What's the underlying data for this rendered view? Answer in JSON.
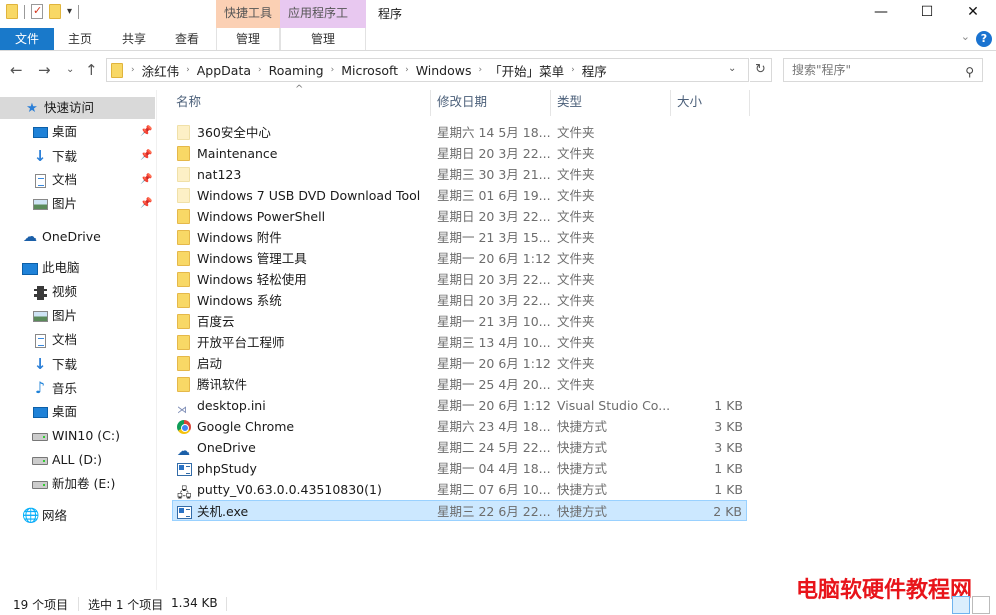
{
  "window": {
    "title": "程序",
    "context_tabs": [
      "快捷工具",
      "应用程序工具"
    ],
    "controls": {
      "minimize": "—",
      "maximize": "☐",
      "close": "✕"
    }
  },
  "ribbon": {
    "file": "文件",
    "tabs": [
      "主页",
      "共享",
      "查看"
    ],
    "context_subtabs": [
      "管理",
      "管理"
    ],
    "help": "?",
    "collapse": "⌄"
  },
  "nav": {
    "back": "←",
    "forward": "→",
    "recent": "⌄",
    "up": "↑",
    "breadcrumb": [
      "涂红伟",
      "AppData",
      "Roaming",
      "Microsoft",
      "Windows",
      "「开始」菜单",
      "程序"
    ],
    "refresh": "↻",
    "search_placeholder": "搜索\"程序\"",
    "search_icon": "⚲"
  },
  "sidebar": {
    "quick_access": {
      "label": "快速访问",
      "icon": "star-icon"
    },
    "quick_items": [
      {
        "label": "桌面",
        "icon": "desktop-icon",
        "pinned": true
      },
      {
        "label": "下载",
        "icon": "download-icon",
        "pinned": true
      },
      {
        "label": "文档",
        "icon": "documents-icon",
        "pinned": true
      },
      {
        "label": "图片",
        "icon": "pictures-icon",
        "pinned": true
      }
    ],
    "onedrive": {
      "label": "OneDrive",
      "icon": "onedrive-icon"
    },
    "this_pc": {
      "label": "此电脑",
      "icon": "computer-icon"
    },
    "pc_items": [
      {
        "label": "视频",
        "icon": "videos-icon"
      },
      {
        "label": "图片",
        "icon": "pictures-icon"
      },
      {
        "label": "文档",
        "icon": "documents-icon"
      },
      {
        "label": "下载",
        "icon": "download-icon"
      },
      {
        "label": "音乐",
        "icon": "music-icon"
      },
      {
        "label": "桌面",
        "icon": "desktop-icon"
      },
      {
        "label": "WIN10 (C:)",
        "icon": "drive-icon"
      },
      {
        "label": "ALL (D:)",
        "icon": "drive-icon"
      },
      {
        "label": "新加卷 (E:)",
        "icon": "drive-icon"
      }
    ],
    "network": {
      "label": "网络",
      "icon": "network-icon"
    }
  },
  "columns": {
    "name": "名称",
    "date": "修改日期",
    "type": "类型",
    "size": "大小"
  },
  "files": [
    {
      "name": "360安全中心",
      "date": "星期六 14 5月 18...",
      "type": "文件夹",
      "size": "",
      "icon": "folder-light"
    },
    {
      "name": "Maintenance",
      "date": "星期日 20 3月 22...",
      "type": "文件夹",
      "size": "",
      "icon": "folder"
    },
    {
      "name": "nat123",
      "date": "星期三 30 3月 21...",
      "type": "文件夹",
      "size": "",
      "icon": "folder-light"
    },
    {
      "name": "Windows 7 USB DVD Download Tool",
      "date": "星期三 01 6月 19...",
      "type": "文件夹",
      "size": "",
      "icon": "folder-light"
    },
    {
      "name": "Windows PowerShell",
      "date": "星期日 20 3月 22...",
      "type": "文件夹",
      "size": "",
      "icon": "folder"
    },
    {
      "name": "Windows 附件",
      "date": "星期一 21 3月 15...",
      "type": "文件夹",
      "size": "",
      "icon": "folder"
    },
    {
      "name": "Windows 管理工具",
      "date": "星期一 20 6月 1:12",
      "type": "文件夹",
      "size": "",
      "icon": "folder"
    },
    {
      "name": "Windows 轻松使用",
      "date": "星期日 20 3月 22...",
      "type": "文件夹",
      "size": "",
      "icon": "folder"
    },
    {
      "name": "Windows 系统",
      "date": "星期日 20 3月 22...",
      "type": "文件夹",
      "size": "",
      "icon": "folder"
    },
    {
      "name": "百度云",
      "date": "星期一 21 3月 10...",
      "type": "文件夹",
      "size": "",
      "icon": "folder"
    },
    {
      "name": "开放平台工程师",
      "date": "星期三 13 4月 10...",
      "type": "文件夹",
      "size": "",
      "icon": "folder"
    },
    {
      "name": "启动",
      "date": "星期一 20 6月 1:12",
      "type": "文件夹",
      "size": "",
      "icon": "folder"
    },
    {
      "name": "腾讯软件",
      "date": "星期一 25 4月 20...",
      "type": "文件夹",
      "size": "",
      "icon": "folder"
    },
    {
      "name": "desktop.ini",
      "date": "星期一 20 6月 1:12",
      "type": "Visual Studio Co...",
      "size": "1 KB",
      "icon": "ini"
    },
    {
      "name": "Google Chrome",
      "date": "星期六 23 4月 18...",
      "type": "快捷方式",
      "size": "3 KB",
      "icon": "chrome"
    },
    {
      "name": "OneDrive",
      "date": "星期二 24 5月 22...",
      "type": "快捷方式",
      "size": "3 KB",
      "icon": "onedrive"
    },
    {
      "name": "phpStudy",
      "date": "星期一 04 4月 18...",
      "type": "快捷方式",
      "size": "1 KB",
      "icon": "app"
    },
    {
      "name": "putty_V0.63.0.0.43510830(1)",
      "date": "星期二 07 6月 10...",
      "type": "快捷方式",
      "size": "1 KB",
      "icon": "putty"
    },
    {
      "name": "关机.exe",
      "date": "星期三 22 6月 22...",
      "type": "快捷方式",
      "size": "2 KB",
      "icon": "app",
      "selected": true
    }
  ],
  "status": {
    "count": "19 个项目",
    "selected": "选中 1 个项目",
    "selected_size": "1.34 KB"
  },
  "watermark": "电脑软硬件教程网",
  "colors": {
    "accent": "#1979ca",
    "selection": "#cce8ff",
    "ctx_shortcut": "#fbd0b4",
    "ctx_app": "#e8c8f0"
  }
}
